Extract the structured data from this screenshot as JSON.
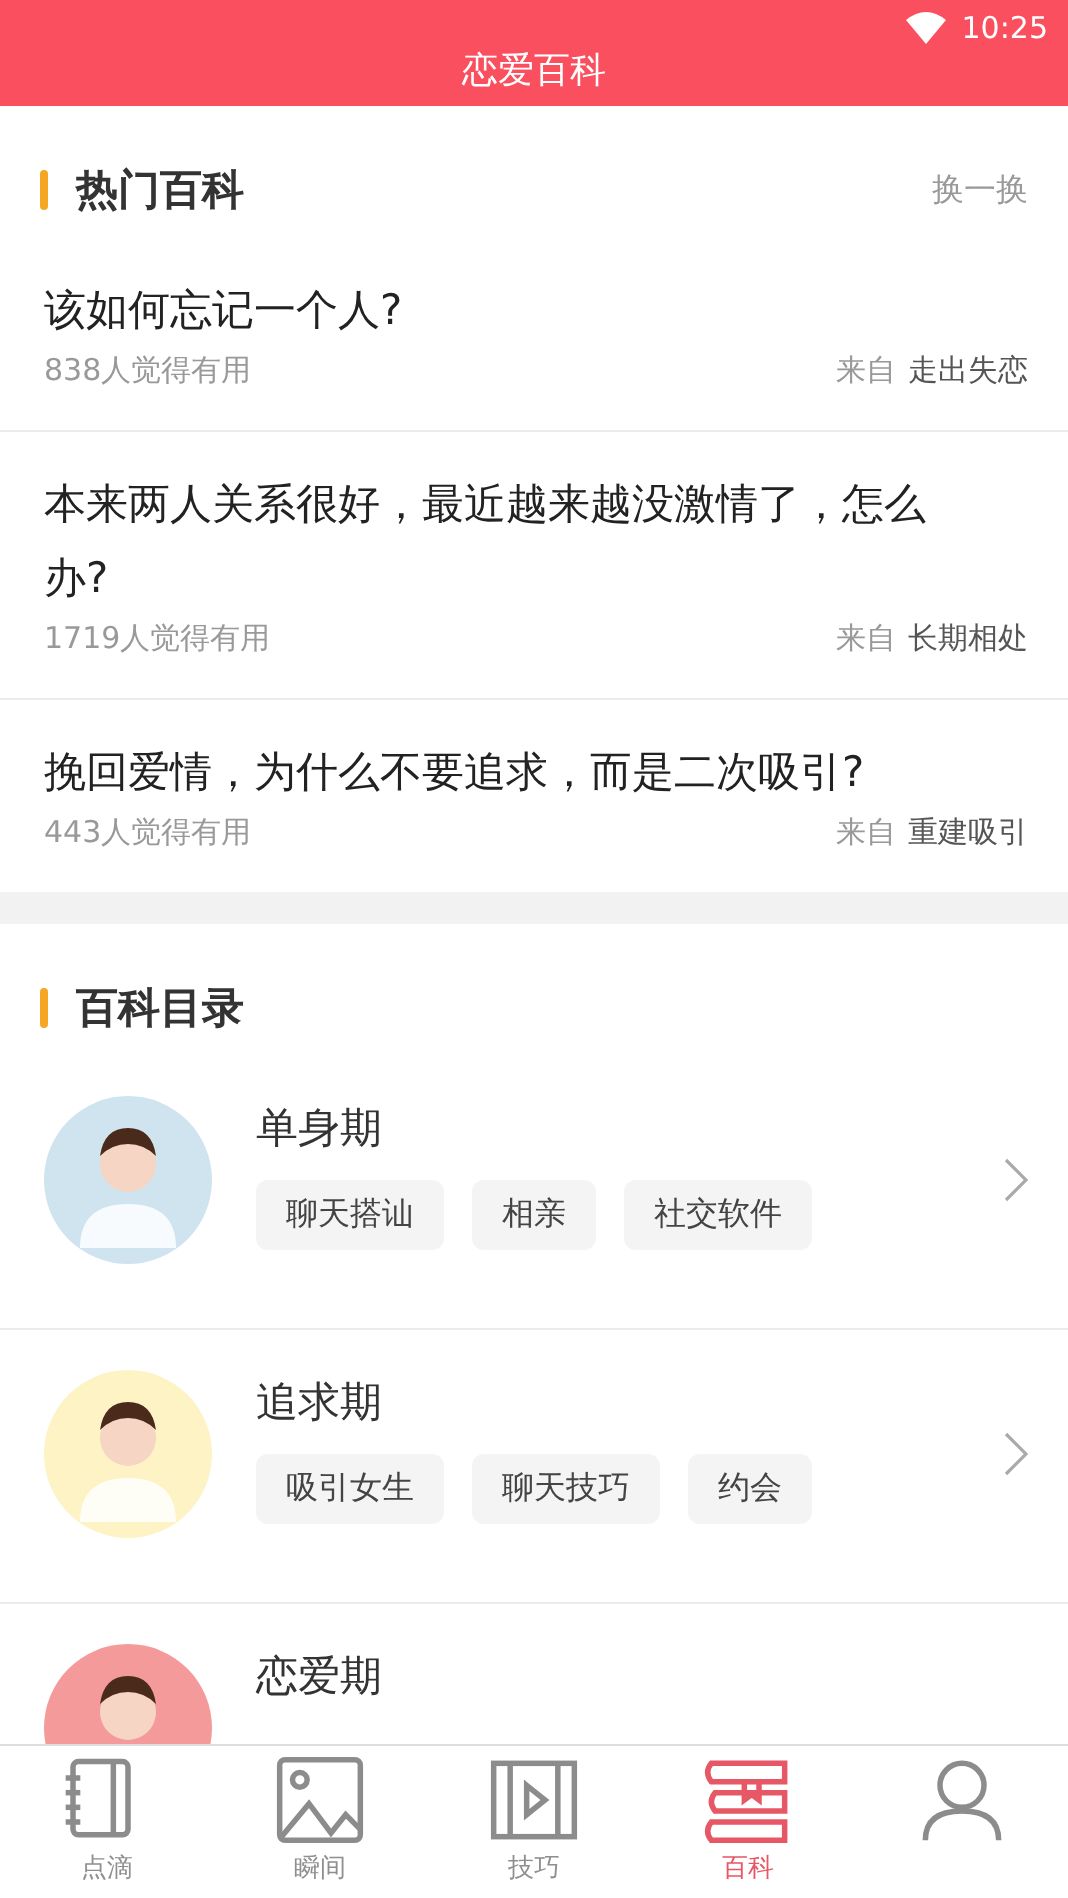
{
  "status_bar": {
    "time": "10:25"
  },
  "header": {
    "title": "恋爱百科"
  },
  "hot": {
    "title": "热门百科",
    "action": "换一换",
    "items": [
      {
        "question": "该如何忘记一个人?",
        "useful": "838人觉得有用",
        "from_label": "来自",
        "from": "走出失恋"
      },
      {
        "question": "本来两人关系很好，最近越来越没激情了，怎么办?",
        "useful": "1719人觉得有用",
        "from_label": "来自",
        "from": "长期相处"
      },
      {
        "question": "挽回爱情，为什么不要追求，而是二次吸引?",
        "useful": "443人觉得有用",
        "from_label": "来自",
        "from": "重建吸引"
      }
    ]
  },
  "catalog": {
    "title": "百科目录",
    "items": [
      {
        "name": "单身期",
        "color": "#cfe4ee",
        "tags": [
          "聊天搭讪",
          "相亲",
          "社交软件"
        ]
      },
      {
        "name": "追求期",
        "color": "#fdf3c4",
        "tags": [
          "吸引女生",
          "聊天技巧",
          "约会"
        ]
      },
      {
        "name": "恋爱期",
        "color": "#f59a9a"
      }
    ]
  },
  "nav": [
    {
      "kind": "notebook",
      "label": "点滴",
      "selected": false
    },
    {
      "kind": "image",
      "label": "瞬间",
      "selected": false
    },
    {
      "kind": "film",
      "label": "技巧",
      "selected": false
    },
    {
      "kind": "books",
      "label": "百科",
      "selected": true
    },
    {
      "kind": "person",
      "selected": false
    }
  ]
}
